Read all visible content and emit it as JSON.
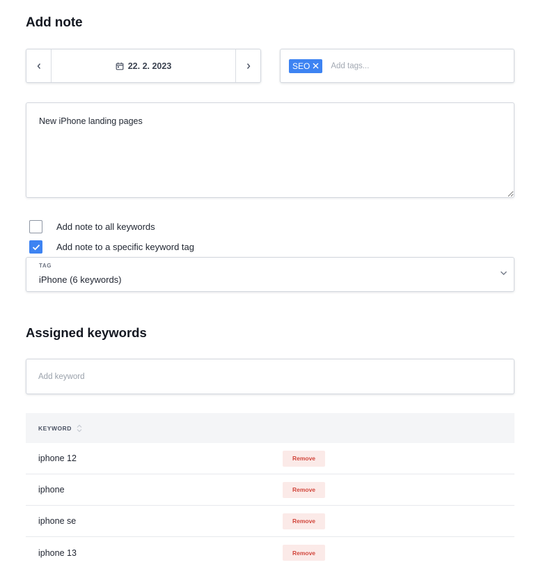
{
  "page": {
    "title": "Add note"
  },
  "date_picker": {
    "date": "22. 2. 2023",
    "prev_icon": "chevron-left-icon",
    "next_icon": "chevron-right-icon",
    "calendar_icon": "calendar-icon"
  },
  "tags": {
    "chips": [
      {
        "label": "SEO"
      }
    ],
    "placeholder": "Add tags...",
    "chip_color": "#3d83f2"
  },
  "note": {
    "value": "New iPhone landing pages"
  },
  "options": {
    "all_keywords": {
      "label": "Add note to all keywords",
      "checked": false
    },
    "specific_tag": {
      "label": "Add note to a specific keyword tag",
      "checked": true
    }
  },
  "tag_select": {
    "caption": "TAG",
    "value": "iPhone (6 keywords)"
  },
  "assigned": {
    "title": "Assigned keywords",
    "input_placeholder": "Add keyword",
    "table": {
      "column_header": "KEYWORD",
      "rows": [
        {
          "keyword": "iphone 12",
          "action": "Remove"
        },
        {
          "keyword": "iphone",
          "action": "Remove"
        },
        {
          "keyword": "iphone se",
          "action": "Remove"
        },
        {
          "keyword": "iphone 13",
          "action": "Remove"
        }
      ]
    }
  },
  "colors": {
    "accent": "#3d83f2",
    "danger": "#d2473d",
    "danger_bg": "#fbeae8"
  }
}
